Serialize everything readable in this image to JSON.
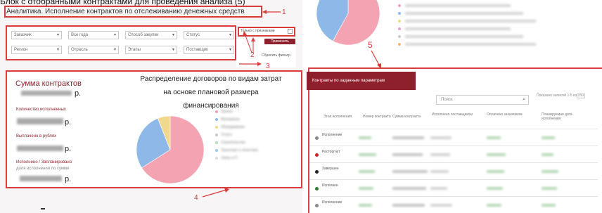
{
  "caption": "Блок с отобранными контрактами для проведения анализа (5)",
  "title": "Аналитика. Исполнение контрактов по отслеживанию денежных средств",
  "filters": {
    "row1": [
      "Заказчик",
      "Все года",
      "Способ закупки",
      "Статус"
    ],
    "row2": [
      "Регион",
      "Отрасль",
      "Этапы",
      "Поставщик"
    ]
  },
  "side": {
    "checkbox_label": "Только с признаками",
    "apply_button": "Применить",
    "reset_link": "Сбросить фильтр"
  },
  "markers": [
    "1",
    "2",
    "3",
    "4",
    "5"
  ],
  "summary": {
    "title": "Сумма контрактов",
    "currency": "р.",
    "labels": [
      "Количество исполненных",
      "Выплачено в рублях",
      "Исполнено / Запланировано",
      "доля исполнения по сумме"
    ]
  },
  "chart": {
    "title_lines": [
      "Распределение договоров по видам затрат",
      "на основе плановой размера",
      "финансирования"
    ],
    "legend": [
      {
        "label": "Прочее",
        "color": "#f4a3b3"
      },
      {
        "label": "Материалы",
        "color": "#8db8e8"
      },
      {
        "label": "Оборудование",
        "color": "#f0d98c"
      },
      {
        "label": "Услуги",
        "color": "#c8c8c8"
      },
      {
        "label": "Строительство",
        "color": "#b6e0b6"
      },
      {
        "label": "Транспорт и логистика",
        "color": "#9bc9e8"
      },
      {
        "label": "Связь и IT",
        "color": "#dcdcdc"
      }
    ],
    "slices": [
      {
        "value": 66,
        "color": "#f4a3b3"
      },
      {
        "value": 28,
        "color": "#8db8e8"
      },
      {
        "value": 6,
        "color": "#f0d98c"
      }
    ]
  },
  "top_right": {
    "pie_slices": [
      {
        "value": 58,
        "color": "#f4a3b3"
      },
      {
        "value": 42,
        "color": "#8db8e8"
      }
    ],
    "legend_colors": [
      "#f4a3b3",
      "#8db8e8",
      "#f0d98c",
      "#e6a0d8",
      "#c8c8c8",
      "#f7b37a"
    ]
  },
  "table": {
    "tab_label": "Контракты по заданным параметрам",
    "search_placeholder": "Поиск",
    "page_info": "Показано записей 1-5 из 150",
    "headers": [
      "Этап исполнения",
      "Номер контракта",
      "Сумма контракта",
      "Исполнено поставщиком",
      "Оплачено заказчиком",
      "Планируемая дата исполнения"
    ],
    "rows": [
      {
        "stage": "Исполнение",
        "color": "#888888"
      },
      {
        "stage": "Расторгнут",
        "color": "#c62828"
      },
      {
        "stage": "Завершен",
        "color": "#222222"
      },
      {
        "stage": "Исполнен",
        "color": "#2e7d32"
      },
      {
        "stage": "Исполнение",
        "color": "#888888"
      }
    ]
  }
}
